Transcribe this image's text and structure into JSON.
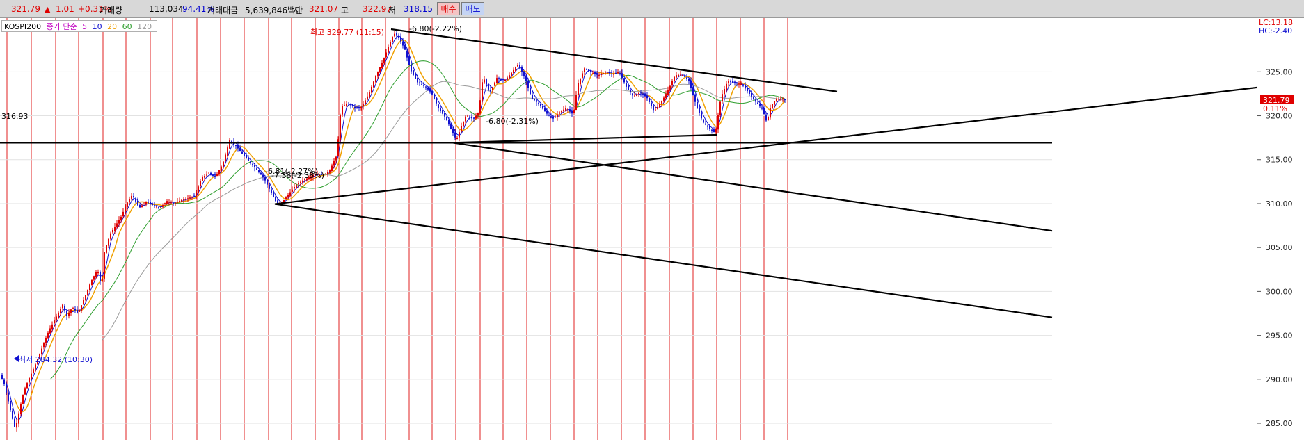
{
  "toolbar": {
    "price": "321.79",
    "up_arrow": "▲",
    "change": "1.01",
    "change_pct": "+0.31%",
    "volume_label": "거래량",
    "volume": "113,034",
    "volume_ratio": "94.41%",
    "amount_label": "거래대금",
    "amount": "5,639,846백만",
    "open_label": "시",
    "open": "321.07",
    "high_label": "고",
    "high": "322.97",
    "low_label": "저",
    "low": "318.15",
    "buy_label": "매수",
    "sell_label": "매도"
  },
  "legend": {
    "symbol": "KOSPI200",
    "ma_label": "종가 단순",
    "ma5": "5",
    "ma10": "10",
    "ma20": "20",
    "ma60": "60",
    "ma120": "120"
  },
  "corner": {
    "lc": "LC:13.18",
    "hc": "HC:-2.40"
  },
  "annotations": {
    "high": "최고 329.77 (11:15)",
    "low": "최저 284.32 (10:30)",
    "level": "316.93",
    "top_pct": "-6.80(-2.22%)",
    "mid_pct": "-6.80(-2.31%)",
    "left_pct": "-6.81(-2.27%)",
    "left_pct2": "-7.38(-2.38%)",
    "current_price": "321.79",
    "current_pct": "0.11%"
  },
  "colors": {
    "up": "#e00000",
    "down": "#1010d0",
    "ma5": "#1010d0",
    "ma10": "#f0a000",
    "ma20": "#2e9e2e",
    "ma60": "#9a9a9a",
    "grid_v": "#e02020",
    "trend": "#000000"
  },
  "chart_data": {
    "type": "line",
    "y_ticks": [
      "325.00",
      "320.00",
      "315.00",
      "310.00",
      "305.00",
      "300.00",
      "295.00",
      "290.00",
      "285.00"
    ],
    "ylim": [
      283.5,
      329.85
    ],
    "close_path": [
      [
        0,
        290.5
      ],
      [
        6,
        289.5
      ],
      [
        12,
        287.5
      ],
      [
        18,
        285.5
      ],
      [
        22,
        284.32
      ],
      [
        28,
        286.5
      ],
      [
        34,
        288.5
      ],
      [
        40,
        289.8
      ],
      [
        50,
        291.5
      ],
      [
        60,
        293.5
      ],
      [
        70,
        295.5
      ],
      [
        80,
        297.0
      ],
      [
        90,
        298.5
      ],
      [
        96,
        297.2
      ],
      [
        104,
        298.2
      ],
      [
        112,
        297.5
      ],
      [
        120,
        299.0
      ],
      [
        130,
        301.0
      ],
      [
        140,
        302.5
      ],
      [
        146,
        300.5
      ],
      [
        150,
        304.5
      ],
      [
        158,
        306.5
      ],
      [
        166,
        307.5
      ],
      [
        174,
        308.5
      ],
      [
        182,
        310.0
      ],
      [
        190,
        311.0
      ],
      [
        200,
        309.5
      ],
      [
        210,
        310.2
      ],
      [
        220,
        309.8
      ],
      [
        230,
        309.5
      ],
      [
        240,
        310.3
      ],
      [
        250,
        310.0
      ],
      [
        260,
        310.4
      ],
      [
        270,
        310.6
      ],
      [
        280,
        310.9
      ],
      [
        290,
        313.0
      ],
      [
        300,
        313.4
      ],
      [
        310,
        313.1
      ],
      [
        320,
        314.5
      ],
      [
        330,
        317.2
      ],
      [
        340,
        316.5
      ],
      [
        350,
        315.5
      ],
      [
        360,
        314.6
      ],
      [
        370,
        313.8
      ],
      [
        380,
        312.8
      ],
      [
        390,
        311.2
      ],
      [
        398,
        310.0
      ],
      [
        406,
        310.2
      ],
      [
        414,
        311.0
      ],
      [
        424,
        312.0
      ],
      [
        434,
        312.6
      ],
      [
        444,
        313.0
      ],
      [
        454,
        313.4
      ],
      [
        464,
        313.2
      ],
      [
        474,
        313.8
      ],
      [
        484,
        315.5
      ],
      [
        490,
        321.0
      ],
      [
        500,
        321.4
      ],
      [
        510,
        320.9
      ],
      [
        520,
        321.0
      ],
      [
        530,
        322.5
      ],
      [
        540,
        324.5
      ],
      [
        550,
        326.2
      ],
      [
        558,
        327.8
      ],
      [
        566,
        329.4
      ],
      [
        574,
        328.8
      ],
      [
        582,
        327.5
      ],
      [
        590,
        325.2
      ],
      [
        600,
        323.8
      ],
      [
        610,
        323.4
      ],
      [
        620,
        322.6
      ],
      [
        630,
        320.9
      ],
      [
        640,
        319.8
      ],
      [
        650,
        318.2
      ],
      [
        656,
        317.2
      ],
      [
        662,
        318.6
      ],
      [
        670,
        320.1
      ],
      [
        680,
        319.6
      ],
      [
        688,
        320.4
      ],
      [
        694,
        324.5
      ],
      [
        704,
        322.6
      ],
      [
        714,
        324.3
      ],
      [
        724,
        323.9
      ],
      [
        734,
        324.8
      ],
      [
        744,
        325.8
      ],
      [
        754,
        324.4
      ],
      [
        764,
        322.0
      ],
      [
        774,
        321.4
      ],
      [
        784,
        320.4
      ],
      [
        794,
        319.6
      ],
      [
        804,
        320.4
      ],
      [
        814,
        320.9
      ],
      [
        824,
        320.1
      ],
      [
        830,
        323.5
      ],
      [
        840,
        325.4
      ],
      [
        850,
        324.9
      ],
      [
        860,
        324.6
      ],
      [
        870,
        325.0
      ],
      [
        880,
        324.7
      ],
      [
        890,
        325.0
      ],
      [
        900,
        323.3
      ],
      [
        910,
        322.2
      ],
      [
        920,
        322.7
      ],
      [
        930,
        322.0
      ],
      [
        940,
        320.5
      ],
      [
        950,
        321.5
      ],
      [
        960,
        322.9
      ],
      [
        970,
        324.6
      ],
      [
        980,
        324.7
      ],
      [
        990,
        324.0
      ],
      [
        1000,
        321.3
      ],
      [
        1010,
        319.3
      ],
      [
        1020,
        318.5
      ],
      [
        1028,
        318.0
      ],
      [
        1036,
        322.1
      ],
      [
        1046,
        324.0
      ],
      [
        1056,
        323.7
      ],
      [
        1066,
        323.6
      ],
      [
        1076,
        322.6
      ],
      [
        1086,
        321.6
      ],
      [
        1096,
        320.7
      ],
      [
        1102,
        319.2
      ],
      [
        1108,
        321.2
      ],
      [
        1116,
        321.9
      ],
      [
        1124,
        322.0
      ],
      [
        1130,
        321.79
      ]
    ],
    "trend_lines": [
      [
        [
          562,
          329.85
        ],
        [
          1203,
          322.75
        ]
      ],
      [
        [
          395,
          309.95
        ],
        [
          1874,
          323.85
        ]
      ],
      [
        [
          0,
          316.93
        ],
        [
          1512,
          316.93
        ]
      ],
      [
        [
          650,
          316.93
        ],
        [
          1512,
          306.9
        ]
      ],
      [
        [
          395,
          309.95
        ],
        [
          1512,
          297.05
        ]
      ],
      [
        [
          650,
          316.93
        ],
        [
          1030,
          317.83
        ]
      ]
    ]
  }
}
